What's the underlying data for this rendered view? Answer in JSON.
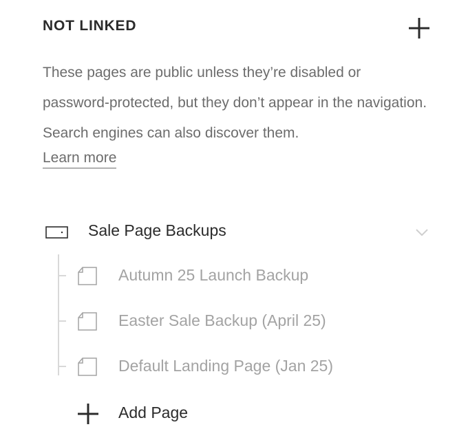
{
  "section": {
    "title": "NOT LINKED",
    "add_icon": "plus-icon"
  },
  "description": {
    "text": "These pages are public unless they’re disabled or password-protected, but they don’t appear in the navigation. Search engines can also discover them.",
    "learn_more": "Learn more"
  },
  "folder": {
    "label": "Sale Page Backups",
    "icon": "folder-icon",
    "expand_icon": "chevron-down-icon",
    "pages": [
      {
        "label": "Autumn 25 Launch Backup",
        "icon": "page-icon"
      },
      {
        "label": "Easter Sale Backup (April 25)",
        "icon": "page-icon"
      },
      {
        "label": "Default Landing Page (Jan 25)",
        "icon": "page-icon"
      }
    ]
  },
  "add_page": {
    "label": "Add Page",
    "icon": "plus-icon"
  },
  "colors": {
    "heading": "#2b2b2b",
    "body_text": "#6c6c6c",
    "muted_text": "#a3a3a3",
    "tree_line": "#d8d8d8",
    "background": "#ffffff"
  }
}
